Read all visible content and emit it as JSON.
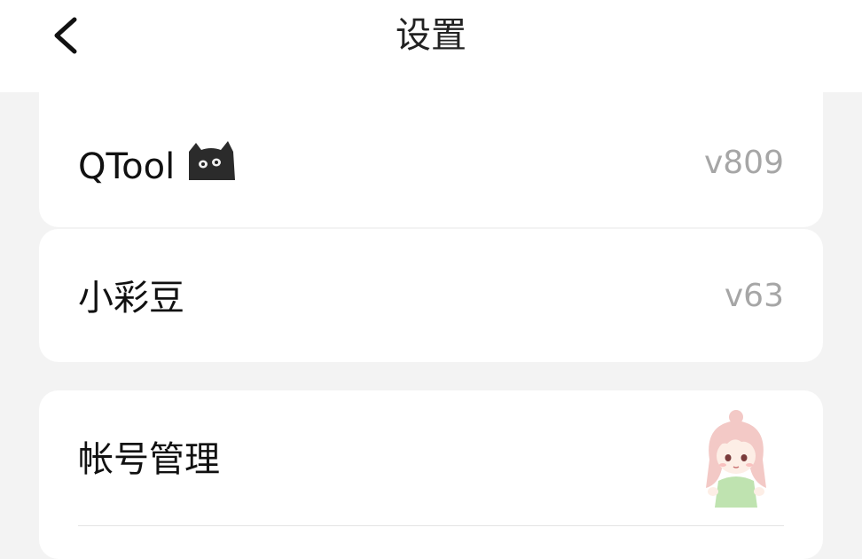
{
  "header": {
    "title": "设置",
    "back_icon": "chevron-left-icon"
  },
  "rows": [
    {
      "label": "QTool",
      "badge_icon": "black-cat-icon",
      "value": "v809"
    },
    {
      "label": "小彩豆",
      "value": "v63"
    },
    {
      "label": "帐号管理",
      "avatar_icon": "anime-girl-avatar-icon"
    }
  ],
  "colors": {
    "background": "#f3f3f3",
    "card": "#ffffff",
    "value_text": "#a6a6a6"
  }
}
